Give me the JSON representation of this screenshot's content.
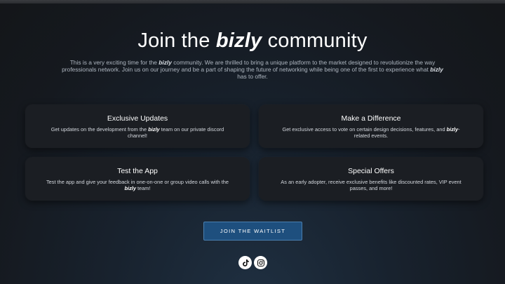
{
  "hero": {
    "title_before": "Join the",
    "brand": "bizly",
    "title_after": "community",
    "desc_part1": "This is a very exciting time for the ",
    "desc_brand1": "bizly",
    "desc_part2": " community. We are thrilled to bring a unique platform to the market designed to revolutionize the way professionals network. Join us on our journey and be a part of shaping the future of networking while being one of the first to experience what ",
    "desc_brand2": "bizly",
    "desc_part3": " has to offer."
  },
  "cards": [
    {
      "title": "Exclusive Updates",
      "desc_before": "Get updates on the development from the ",
      "brand": "bizly",
      "desc_after": " team on our private discord channel!"
    },
    {
      "title": "Make a Difference",
      "desc_before": "Get exclusive access to vote on certain design decisions, features, and ",
      "brand": "bizly",
      "desc_after": "-related events."
    },
    {
      "title": "Test the App",
      "desc_before": "Test the app and give your feedback in one-on-one or group video calls with the ",
      "brand": "bizly",
      "desc_after": " team!"
    },
    {
      "title": "Special Offers",
      "desc_before": "As an early adopter, receive exclusive benefits like discounted rates, VIP event passes, and more!",
      "brand": "",
      "desc_after": ""
    }
  ],
  "cta": {
    "label": "JOIN THE WAITLIST"
  },
  "social": [
    "tiktok-icon",
    "instagram-icon"
  ],
  "colors": {
    "button": "#1e4f7e",
    "button_border": "#4a7fb0",
    "card": "#1b1e23"
  }
}
